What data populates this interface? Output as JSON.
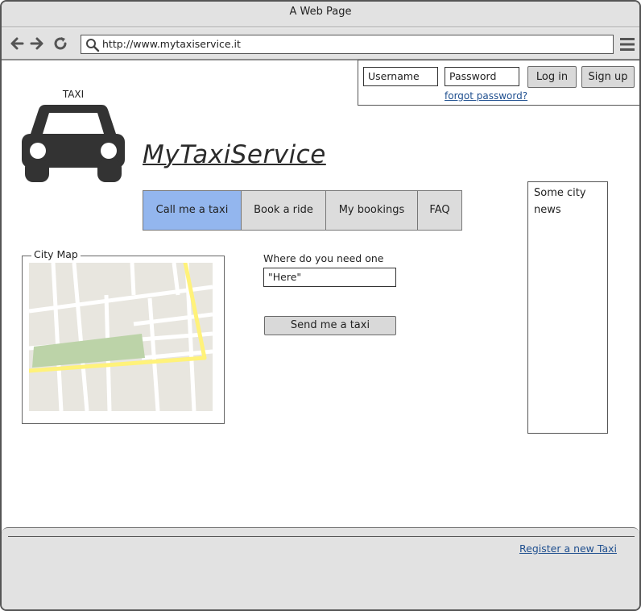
{
  "browser": {
    "title": "A Web Page",
    "url": "http://www.mytaxiservice.it"
  },
  "login": {
    "username_placeholder": "Username",
    "password_placeholder": "Password",
    "login_label": "Log in",
    "signup_label": "Sign up",
    "forgot_label": "forgot password?"
  },
  "logo": {
    "caption": "TAXI",
    "icon": "taxi-icon"
  },
  "site_title": "MyTaxiService",
  "nav": {
    "tabs": [
      {
        "label": "Call me a taxi",
        "active": true
      },
      {
        "label": "Book a ride",
        "active": false
      },
      {
        "label": "My bookings",
        "active": false
      },
      {
        "label": "FAQ",
        "active": false
      }
    ]
  },
  "news": {
    "text": "Some city news"
  },
  "map": {
    "legend": "City Map"
  },
  "request": {
    "label": "Where do you need one",
    "input_value": "\"Here\"",
    "send_label": "Send me a taxi"
  },
  "footer": {
    "register_label": "Register a new Taxi"
  },
  "colors": {
    "active_tab": "#93b6ee",
    "link": "#1f4f8f",
    "chrome": "#e2e2e2",
    "map_road_major": "#fff27a",
    "map_park": "#bcd3a8",
    "map_block": "#e8e6df"
  }
}
